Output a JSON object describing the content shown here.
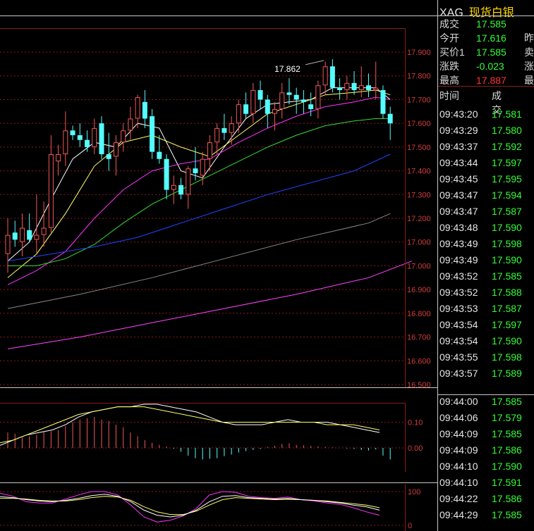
{
  "colors": {
    "up": "#f25858",
    "down": "#54ffff",
    "ma5": "#ffffff",
    "ma10": "#ffff66",
    "ma20": "#ff33ff",
    "ma30": "#33dd33",
    "ma60": "#2244ff",
    "ma120": "#888888",
    "ma250": "#ff44ff",
    "grid": "#8c1a1a",
    "axis_red": "#d23c3c",
    "price_green": "#33ff33",
    "price_red": "#ff3333"
  },
  "header": {
    "code": "XAG",
    "name": "现货白银"
  },
  "quote": [
    {
      "key": "成交",
      "value": "17.585",
      "color": "green",
      "tail": ""
    },
    {
      "key": "今开",
      "value": "17.616",
      "color": "green",
      "tail": "昨"
    },
    {
      "key": "买价1",
      "value": "17.585",
      "color": "green",
      "tail": "卖"
    },
    {
      "key": "涨跌",
      "value": "-0.023",
      "color": "green",
      "tail": "涨"
    },
    {
      "key": "最高",
      "value": "17.887",
      "color": "red",
      "tail": "最"
    }
  ],
  "ticks_header": {
    "time": "时间",
    "price": "成交"
  },
  "ticks": [
    {
      "time": "09:43:20",
      "price": "17.581"
    },
    {
      "time": "09:43:29",
      "price": "17.580"
    },
    {
      "time": "09:43:37",
      "price": "17.592"
    },
    {
      "time": "09:43:44",
      "price": "17.597"
    },
    {
      "time": "09:43:45",
      "price": "17.595"
    },
    {
      "time": "09:43:47",
      "price": "17.594"
    },
    {
      "time": "09:43:47",
      "price": "17.587"
    },
    {
      "time": "09:43:48",
      "price": "17.590"
    },
    {
      "time": "09:43:49",
      "price": "17.598"
    },
    {
      "time": "09:43:49",
      "price": "17.590"
    },
    {
      "time": "09:43:52",
      "price": "17.585"
    },
    {
      "time": "09:43:52",
      "price": "17.588"
    },
    {
      "time": "09:43:53",
      "price": "17.587"
    },
    {
      "time": "09:43:54",
      "price": "17.597"
    },
    {
      "time": "09:43:54",
      "price": "17.590"
    },
    {
      "time": "09:43:55",
      "price": "17.598"
    },
    {
      "time": "09:43:57",
      "price": "17.589"
    },
    {
      "time": "09:44:00",
      "price": "17.585"
    },
    {
      "time": "09:44:06",
      "price": "17.579"
    },
    {
      "time": "09:44:09",
      "price": "17.585"
    },
    {
      "time": "09:44:09",
      "price": "17.586"
    },
    {
      "time": "09:44:10",
      "price": "17.590"
    },
    {
      "time": "09:44:10",
      "price": "17.591"
    },
    {
      "time": "09:44:22",
      "price": "17.586"
    },
    {
      "time": "09:44:29",
      "price": "17.585"
    }
  ],
  "chart_data": {
    "type": "candlestick",
    "price_ticks": [
      "17.900",
      "17.800",
      "17.700",
      "17.600",
      "17.500",
      "17.400",
      "17.300",
      "17.200",
      "17.000",
      "17.000",
      "16.900",
      "16.800",
      "16.700",
      "16.600",
      "16.500"
    ],
    "ylim": [
      16.5,
      17.93
    ],
    "annotation": {
      "text": "17.862",
      "value": 17.862,
      "candle_index": 44
    },
    "candles": [
      {
        "o": 17.05,
        "h": 17.2,
        "l": 16.97,
        "c": 17.13
      },
      {
        "o": 17.14,
        "h": 17.19,
        "l": 17.08,
        "c": 17.11
      },
      {
        "o": 17.1,
        "h": 17.22,
        "l": 17.04,
        "c": 17.16
      },
      {
        "o": 17.15,
        "h": 17.22,
        "l": 17.1,
        "c": 17.11
      },
      {
        "o": 17.11,
        "h": 17.3,
        "l": 17.05,
        "c": 17.13
      },
      {
        "o": 17.13,
        "h": 17.27,
        "l": 17.08,
        "c": 17.16
      },
      {
        "o": 17.16,
        "h": 17.55,
        "l": 17.14,
        "c": 17.47
      },
      {
        "o": 17.44,
        "h": 17.51,
        "l": 17.38,
        "c": 17.47
      },
      {
        "o": 17.47,
        "h": 17.65,
        "l": 17.42,
        "c": 17.57
      },
      {
        "o": 17.57,
        "h": 17.59,
        "l": 17.53,
        "c": 17.55
      },
      {
        "o": 17.55,
        "h": 17.6,
        "l": 17.5,
        "c": 17.53
      },
      {
        "o": 17.53,
        "h": 17.57,
        "l": 17.48,
        "c": 17.5
      },
      {
        "o": 17.5,
        "h": 17.62,
        "l": 17.47,
        "c": 17.58
      },
      {
        "o": 17.6,
        "h": 17.63,
        "l": 17.45,
        "c": 17.47
      },
      {
        "o": 17.47,
        "h": 17.56,
        "l": 17.4,
        "c": 17.45
      },
      {
        "o": 17.46,
        "h": 17.55,
        "l": 17.38,
        "c": 17.52
      },
      {
        "o": 17.52,
        "h": 17.6,
        "l": 17.48,
        "c": 17.57
      },
      {
        "o": 17.57,
        "h": 17.67,
        "l": 17.53,
        "c": 17.62
      },
      {
        "o": 17.62,
        "h": 17.72,
        "l": 17.58,
        "c": 17.71
      },
      {
        "o": 17.69,
        "h": 17.74,
        "l": 17.58,
        "c": 17.62
      },
      {
        "o": 17.63,
        "h": 17.66,
        "l": 17.45,
        "c": 17.48
      },
      {
        "o": 17.48,
        "h": 17.55,
        "l": 17.43,
        "c": 17.45
      },
      {
        "o": 17.45,
        "h": 17.47,
        "l": 17.28,
        "c": 17.32
      },
      {
        "o": 17.32,
        "h": 17.38,
        "l": 17.26,
        "c": 17.34
      },
      {
        "o": 17.34,
        "h": 17.37,
        "l": 17.28,
        "c": 17.3
      },
      {
        "o": 17.3,
        "h": 17.42,
        "l": 17.24,
        "c": 17.41
      },
      {
        "o": 17.41,
        "h": 17.5,
        "l": 17.36,
        "c": 17.39
      },
      {
        "o": 17.38,
        "h": 17.48,
        "l": 17.34,
        "c": 17.45
      },
      {
        "o": 17.45,
        "h": 17.55,
        "l": 17.4,
        "c": 17.52
      },
      {
        "o": 17.52,
        "h": 17.6,
        "l": 17.47,
        "c": 17.58
      },
      {
        "o": 17.58,
        "h": 17.64,
        "l": 17.53,
        "c": 17.56
      },
      {
        "o": 17.56,
        "h": 17.63,
        "l": 17.51,
        "c": 17.6
      },
      {
        "o": 17.6,
        "h": 17.7,
        "l": 17.56,
        "c": 17.68
      },
      {
        "o": 17.68,
        "h": 17.73,
        "l": 17.62,
        "c": 17.64
      },
      {
        "o": 17.64,
        "h": 17.77,
        "l": 17.6,
        "c": 17.74
      },
      {
        "o": 17.74,
        "h": 17.78,
        "l": 17.66,
        "c": 17.7
      },
      {
        "o": 17.7,
        "h": 17.72,
        "l": 17.58,
        "c": 17.64
      },
      {
        "o": 17.64,
        "h": 17.69,
        "l": 17.57,
        "c": 17.66
      },
      {
        "o": 17.66,
        "h": 17.77,
        "l": 17.62,
        "c": 17.73
      },
      {
        "o": 17.73,
        "h": 17.79,
        "l": 17.68,
        "c": 17.72
      },
      {
        "o": 17.72,
        "h": 17.75,
        "l": 17.64,
        "c": 17.7
      },
      {
        "o": 17.7,
        "h": 17.74,
        "l": 17.64,
        "c": 17.69
      },
      {
        "o": 17.68,
        "h": 17.73,
        "l": 17.63,
        "c": 17.66
      },
      {
        "o": 17.66,
        "h": 17.78,
        "l": 17.62,
        "c": 17.76
      },
      {
        "o": 17.76,
        "h": 17.86,
        "l": 17.72,
        "c": 17.84
      },
      {
        "o": 17.84,
        "h": 17.87,
        "l": 17.73,
        "c": 17.75
      },
      {
        "o": 17.75,
        "h": 17.79,
        "l": 17.7,
        "c": 17.74
      },
      {
        "o": 17.74,
        "h": 17.8,
        "l": 17.7,
        "c": 17.77
      },
      {
        "o": 17.77,
        "h": 17.82,
        "l": 17.72,
        "c": 17.74
      },
      {
        "o": 17.74,
        "h": 17.84,
        "l": 17.71,
        "c": 17.76
      },
      {
        "o": 17.76,
        "h": 17.81,
        "l": 17.71,
        "c": 17.74
      },
      {
        "o": 17.74,
        "h": 17.86,
        "l": 17.7,
        "c": 17.75
      },
      {
        "o": 17.74,
        "h": 17.76,
        "l": 17.62,
        "c": 17.64
      },
      {
        "o": 17.64,
        "h": 17.67,
        "l": 17.53,
        "c": 17.6
      }
    ],
    "ma": [
      {
        "key": "ma5",
        "points": [
          [
            0,
            17.02
          ],
          [
            3,
            17.1
          ],
          [
            6,
            17.28
          ],
          [
            9,
            17.45
          ],
          [
            12,
            17.52
          ],
          [
            15,
            17.5
          ],
          [
            18,
            17.6
          ],
          [
            21,
            17.58
          ],
          [
            24,
            17.4
          ],
          [
            27,
            17.37
          ],
          [
            30,
            17.5
          ],
          [
            33,
            17.62
          ],
          [
            36,
            17.68
          ],
          [
            39,
            17.69
          ],
          [
            42,
            17.7
          ],
          [
            45,
            17.75
          ],
          [
            48,
            17.75
          ],
          [
            51,
            17.75
          ],
          [
            53,
            17.7
          ]
        ]
      },
      {
        "key": "ma10",
        "points": [
          [
            0,
            16.95
          ],
          [
            4,
            17.05
          ],
          [
            8,
            17.22
          ],
          [
            12,
            17.42
          ],
          [
            16,
            17.52
          ],
          [
            20,
            17.55
          ],
          [
            24,
            17.5
          ],
          [
            28,
            17.46
          ],
          [
            32,
            17.55
          ],
          [
            36,
            17.64
          ],
          [
            40,
            17.68
          ],
          [
            44,
            17.72
          ],
          [
            48,
            17.73
          ],
          [
            51,
            17.74
          ],
          [
            53,
            17.72
          ]
        ]
      },
      {
        "key": "ma20",
        "points": [
          [
            0,
            16.92
          ],
          [
            4,
            16.98
          ],
          [
            8,
            17.06
          ],
          [
            12,
            17.2
          ],
          [
            16,
            17.32
          ],
          [
            20,
            17.4
          ],
          [
            24,
            17.43
          ],
          [
            28,
            17.45
          ],
          [
            32,
            17.52
          ],
          [
            36,
            17.58
          ],
          [
            40,
            17.63
          ],
          [
            44,
            17.67
          ],
          [
            48,
            17.69
          ],
          [
            51,
            17.71
          ],
          [
            53,
            17.7
          ]
        ]
      },
      {
        "key": "ma30",
        "points": [
          [
            0,
            17.0
          ],
          [
            4,
            17.0
          ],
          [
            8,
            17.03
          ],
          [
            12,
            17.09
          ],
          [
            16,
            17.18
          ],
          [
            20,
            17.26
          ],
          [
            24,
            17.32
          ],
          [
            28,
            17.38
          ],
          [
            32,
            17.44
          ],
          [
            36,
            17.5
          ],
          [
            40,
            17.55
          ],
          [
            44,
            17.59
          ],
          [
            48,
            17.61
          ],
          [
            51,
            17.62
          ],
          [
            53,
            17.62
          ]
        ]
      },
      {
        "key": "ma60",
        "points": [
          [
            0,
            17.02
          ],
          [
            6,
            17.05
          ],
          [
            12,
            17.08
          ],
          [
            18,
            17.12
          ],
          [
            24,
            17.18
          ],
          [
            30,
            17.24
          ],
          [
            36,
            17.3
          ],
          [
            42,
            17.35
          ],
          [
            48,
            17.4
          ],
          [
            53,
            17.47
          ]
        ]
      },
      {
        "key": "ma120",
        "points": [
          [
            0,
            16.82
          ],
          [
            10,
            16.88
          ],
          [
            20,
            16.95
          ],
          [
            30,
            17.03
          ],
          [
            40,
            17.11
          ],
          [
            50,
            17.18
          ],
          [
            53,
            17.22
          ]
        ]
      },
      {
        "key": "ma250",
        "points": [
          [
            0,
            16.65
          ],
          [
            10,
            16.7
          ],
          [
            20,
            16.76
          ],
          [
            30,
            16.82
          ],
          [
            40,
            16.88
          ],
          [
            50,
            16.95
          ],
          [
            56,
            17.02
          ]
        ]
      }
    ],
    "macd": {
      "ticks": [
        "0.10",
        "0.00"
      ],
      "bars": [
        0.06,
        0.055,
        0.04,
        0.045,
        0.05,
        0.062,
        0.065,
        0.07,
        0.085,
        0.1,
        0.11,
        0.115,
        0.12,
        0.11,
        0.105,
        0.09,
        0.08,
        0.06,
        0.045,
        0.03,
        0.02,
        0.012,
        0.006,
        -0.003,
        -0.015,
        -0.03,
        -0.04,
        -0.045,
        -0.042,
        -0.04,
        -0.032,
        -0.026,
        -0.018,
        -0.012,
        -0.008,
        -0.004,
        0.004,
        0.008,
        0.015,
        0.018,
        0.012,
        0.01,
        0.008,
        0.006,
        0.004,
        0.002,
        0.0,
        -0.002,
        -0.004,
        -0.008,
        -0.01,
        -0.006,
        -0.03,
        -0.045
      ],
      "dif": [
        0.01,
        0.03,
        0.05,
        0.06,
        0.07,
        0.09,
        0.12,
        0.14,
        0.15,
        0.16,
        0.16,
        0.17,
        0.17,
        0.16,
        0.15,
        0.14,
        0.12,
        0.1,
        0.09,
        0.09,
        0.09,
        0.1,
        0.11,
        0.1,
        0.1,
        0.1,
        0.09,
        0.08,
        0.07,
        0.06
      ],
      "dea": [
        0.02,
        0.03,
        0.05,
        0.07,
        0.09,
        0.11,
        0.13,
        0.14,
        0.15,
        0.16,
        0.16,
        0.16,
        0.15,
        0.14,
        0.13,
        0.12,
        0.11,
        0.1,
        0.1,
        0.1,
        0.1,
        0.1,
        0.1,
        0.1,
        0.1,
        0.09,
        0.09,
        0.09,
        0.08,
        0.07
      ]
    },
    "kdj": {
      "ticks": [
        "100",
        "0"
      ],
      "k": [
        85,
        82,
        76,
        72,
        70,
        74,
        80,
        88,
        92,
        86,
        70,
        45,
        30,
        25,
        30,
        45,
        70,
        86,
        88,
        82,
        80,
        78,
        80,
        76,
        74,
        70,
        66,
        60,
        55,
        45
      ],
      "d": [
        80,
        80,
        78,
        74,
        72,
        72,
        76,
        82,
        86,
        84,
        74,
        55,
        40,
        32,
        32,
        42,
        60,
        76,
        82,
        80,
        78,
        76,
        77,
        76,
        74,
        72,
        68,
        64,
        60,
        52
      ],
      "j": [
        95,
        86,
        70,
        66,
        66,
        78,
        90,
        100,
        100,
        90,
        60,
        25,
        10,
        15,
        28,
        50,
        90,
        100,
        98,
        86,
        82,
        80,
        84,
        76,
        72,
        66,
        62,
        52,
        40,
        30
      ]
    }
  }
}
